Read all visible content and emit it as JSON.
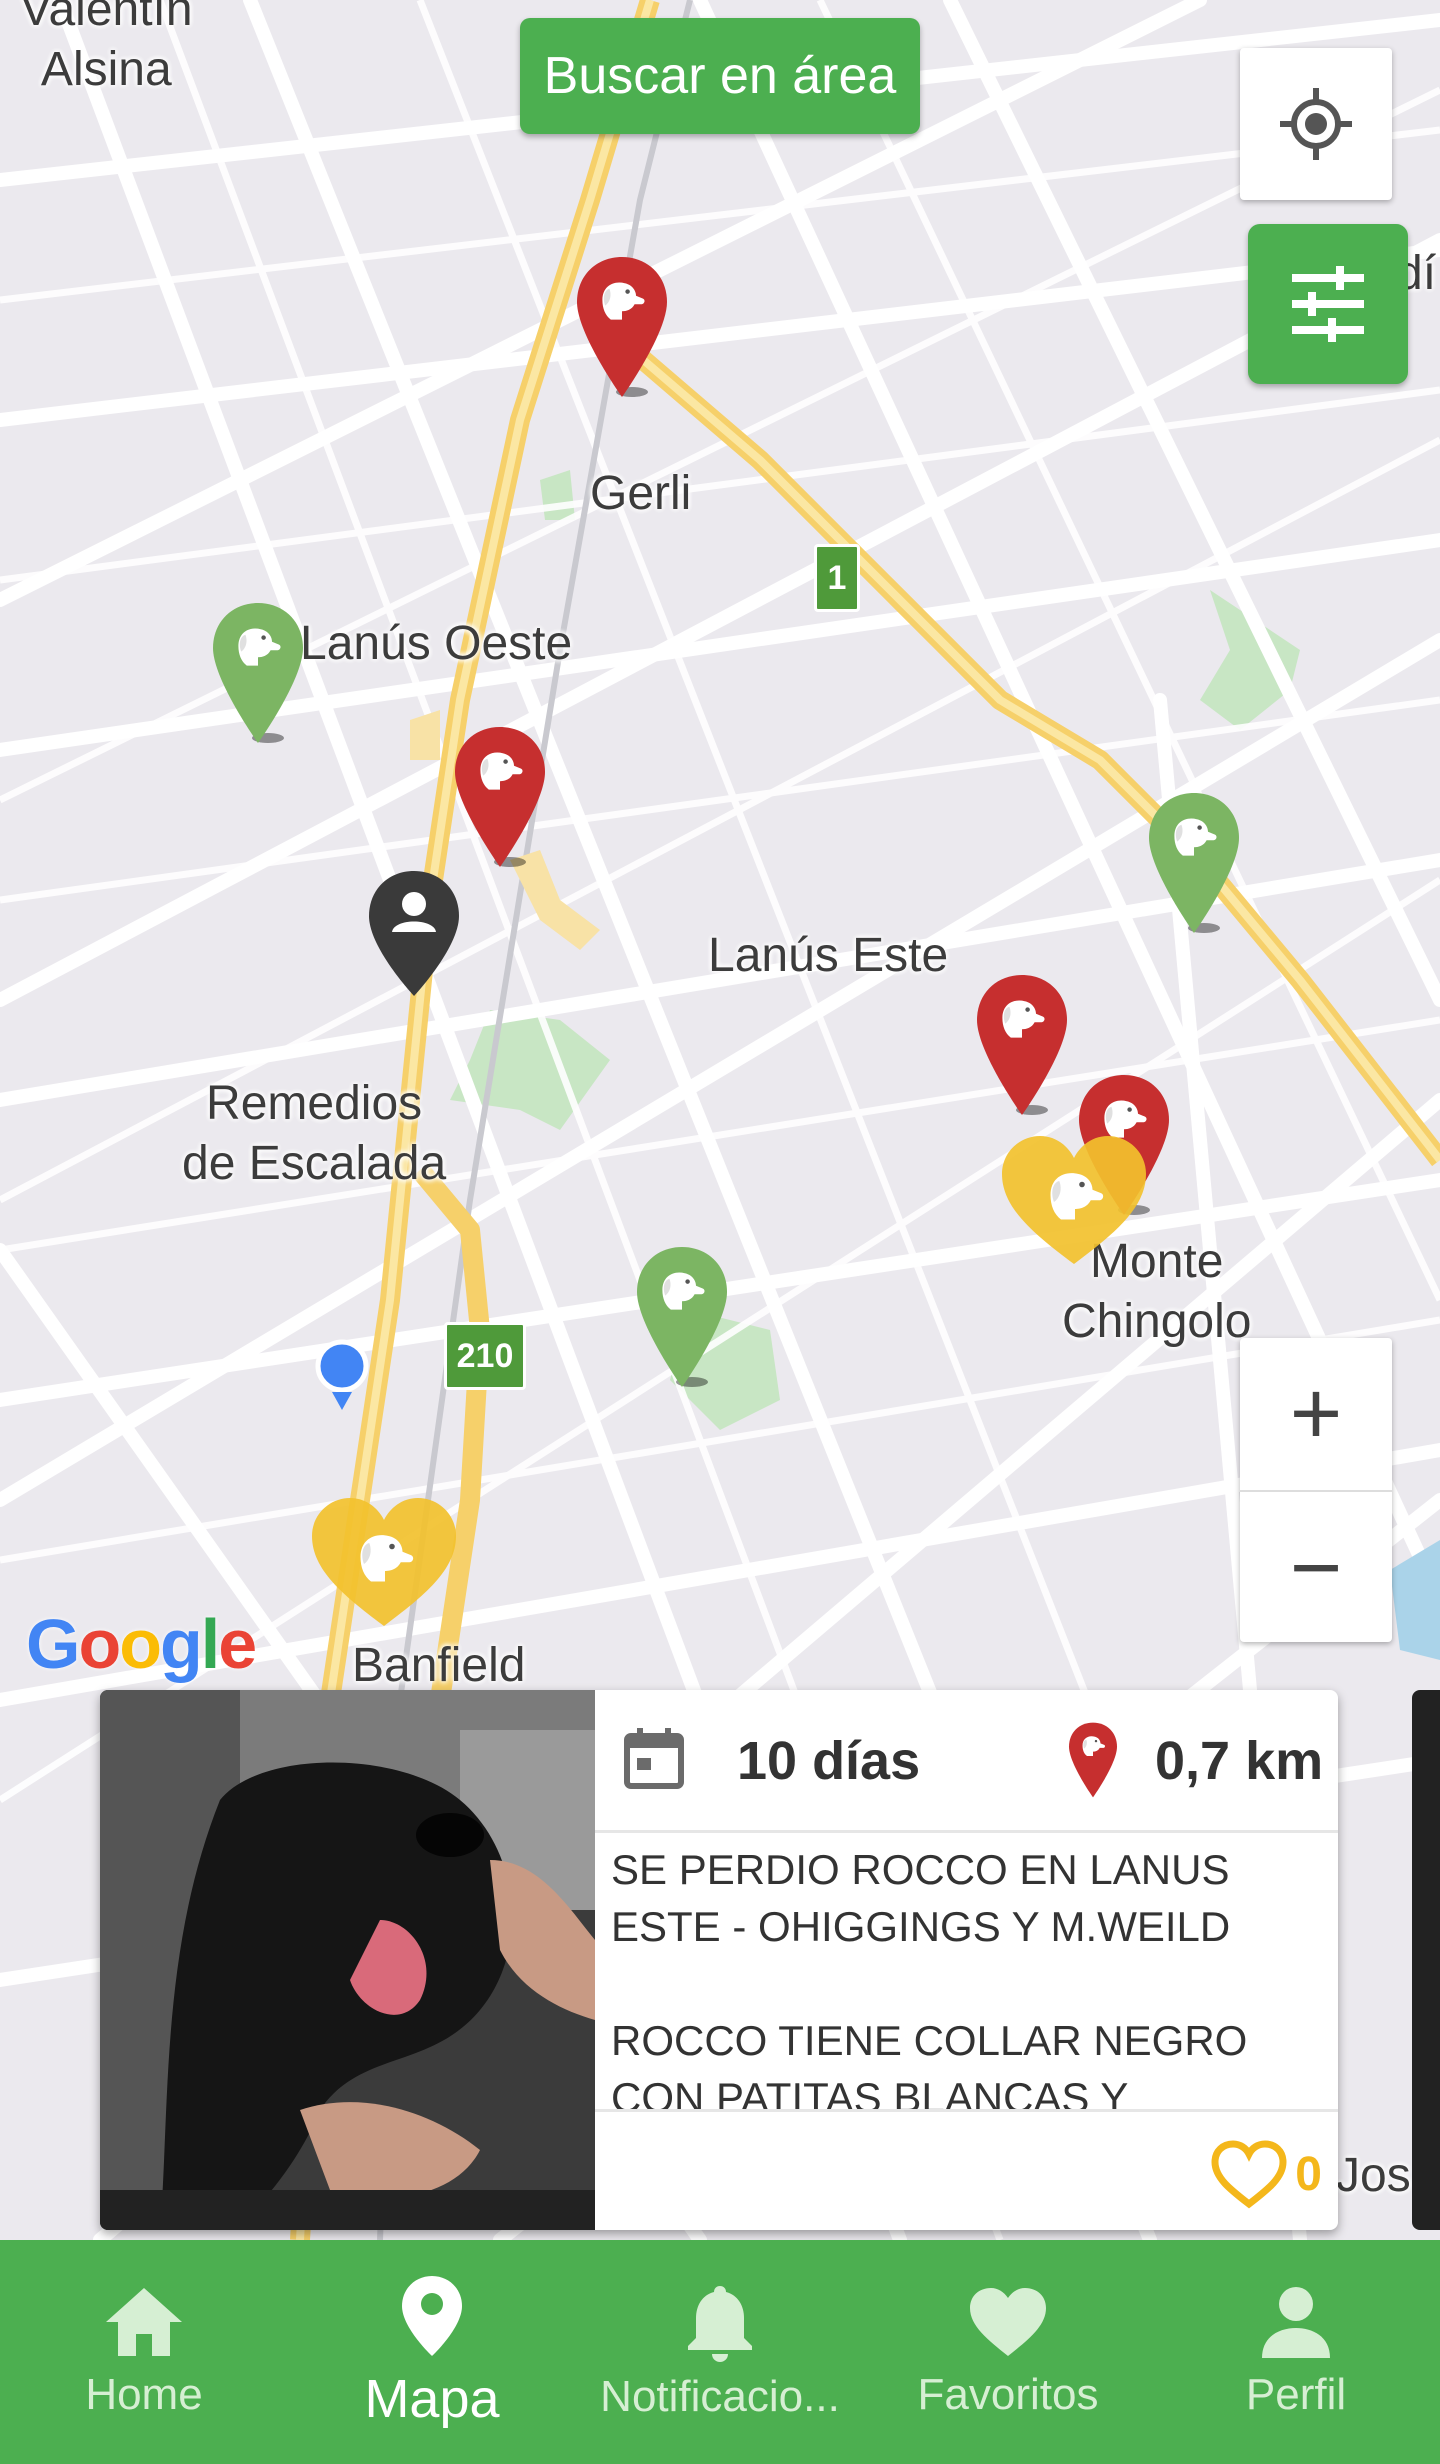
{
  "map": {
    "search_button": "Buscar en área",
    "labels": {
      "valentin_alsina": "Valentín\nAlsina",
      "gerli": "Gerli",
      "lanus_oeste": "Lanús Oeste",
      "lanus_este": "Lanús Este",
      "remedios": "Remedios\nde Escalada",
      "monte_chingolo": "Monte\nChingolo",
      "banfield": "Banfield",
      "edge_top": "dí",
      "edge_bottom": "Jos"
    },
    "shields": {
      "route_1": "1",
      "route_210": "210"
    },
    "zoom_in": "+",
    "zoom_out": "−",
    "attribution": "Google",
    "colors": {
      "lost": "#c62f2f",
      "found": "#7cb563",
      "adoption": "#f2c12e",
      "user": "#3a3a3a",
      "accent": "#4caf50"
    }
  },
  "card": {
    "days": "10 días",
    "distance": "0,7 km",
    "description": "SE PERDIO ROCCO EN LANUS ESTE - OHIGGINGS Y M.WEILD\n\nROCCO TIENE COLLAR NEGRO CON PATITAS BLANCAS Y",
    "likes": "0"
  },
  "nav": {
    "home": "Home",
    "map": "Mapa",
    "notifications": "Notificacio...",
    "favorites": "Favoritos",
    "profile": "Perfil"
  }
}
